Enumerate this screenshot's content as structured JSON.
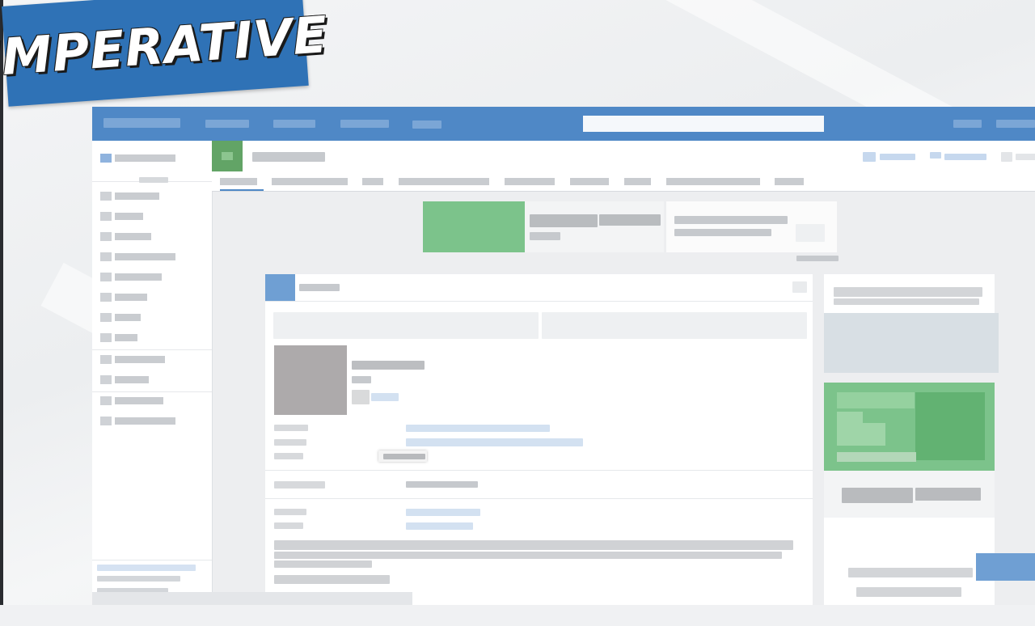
{
  "banner": {
    "text": "IMPERATIVE"
  },
  "colors": {
    "accent_blue": "#4f88c6",
    "banner_blue": "#2f72b6",
    "promo_green": "#7cc38b",
    "promo_dark_green": "#62b272",
    "page_bg": "#edeef0"
  },
  "icons": {
    "sidebar": [
      "square-icon",
      "user-icon",
      "square-icon",
      "square-icon",
      "square-icon",
      "square-icon",
      "square-icon",
      "square-icon",
      "square-icon",
      "square-icon",
      "square-icon",
      "square-icon"
    ],
    "panel_close": "close-icon"
  }
}
